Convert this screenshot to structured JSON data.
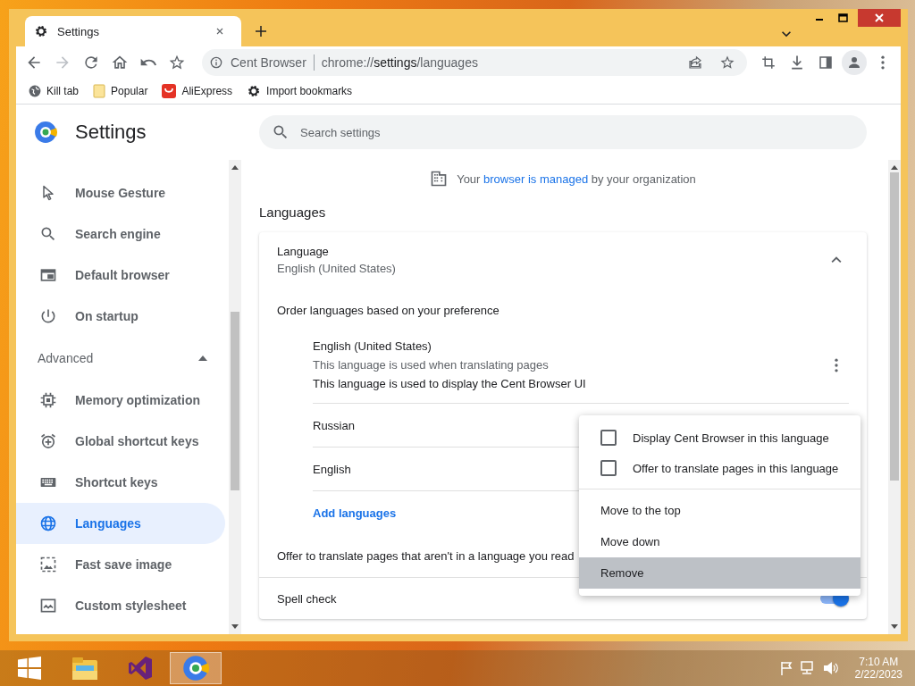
{
  "window": {
    "tab_title": "Settings",
    "site_name": "Cent Browser",
    "url_prefix": "chrome://",
    "url_host": "settings",
    "url_path": "/languages",
    "forward_enabled": false
  },
  "bookmarks": [
    {
      "label": "Kill tab"
    },
    {
      "label": "Popular"
    },
    {
      "label": "AliExpress"
    },
    {
      "label": "Import bookmarks"
    }
  ],
  "sidebar": {
    "title": "Settings",
    "items": [
      {
        "label": "Mouse Gesture",
        "selected": false
      },
      {
        "label": "Search engine",
        "selected": false
      },
      {
        "label": "Default browser",
        "selected": false
      },
      {
        "label": "On startup",
        "selected": false
      }
    ],
    "advanced": {
      "label": "Advanced",
      "expanded": true,
      "items": [
        {
          "label": "Memory optimization",
          "selected": false
        },
        {
          "label": "Global shortcut keys",
          "selected": false
        },
        {
          "label": "Shortcut keys",
          "selected": false
        },
        {
          "label": "Languages",
          "selected": true
        },
        {
          "label": "Fast save image",
          "selected": false
        },
        {
          "label": "Custom stylesheet",
          "selected": false
        }
      ]
    }
  },
  "search": {
    "placeholder": "Search settings"
  },
  "managed_notice": {
    "before": "Your",
    "link": "browser is managed",
    "after": "by your organization"
  },
  "section_title": "Languages",
  "language_card": {
    "label": "Language",
    "value": "English (United States)",
    "expanded": true,
    "order_label": "Order languages based on your preference",
    "languages": [
      {
        "name": "English (United States)",
        "notes": [
          {
            "text": "This language is used when translating pages",
            "muted": true
          },
          {
            "text": "This language is used to display the Cent Browser UI",
            "muted": false
          }
        ]
      },
      {
        "name": "Russian"
      },
      {
        "name": "English"
      }
    ],
    "add_link": "Add languages",
    "offer_translate": "Offer to translate pages that aren't in a language you read",
    "spell_check": {
      "label": "Spell check",
      "on": true
    }
  },
  "context_menu": {
    "options": [
      {
        "label": "Display Cent Browser in this language",
        "checked": false
      },
      {
        "label": "Offer to translate pages in this language",
        "checked": false
      }
    ],
    "actions": [
      {
        "label": "Move to the top",
        "selected": false
      },
      {
        "label": "Move down",
        "selected": false
      },
      {
        "label": "Remove",
        "selected": true
      }
    ]
  },
  "taskbar": {
    "apps": [
      {
        "selected": false
      },
      {
        "selected": false
      },
      {
        "selected": true
      }
    ],
    "time": "7:10 AM",
    "date": "2/22/2023"
  }
}
